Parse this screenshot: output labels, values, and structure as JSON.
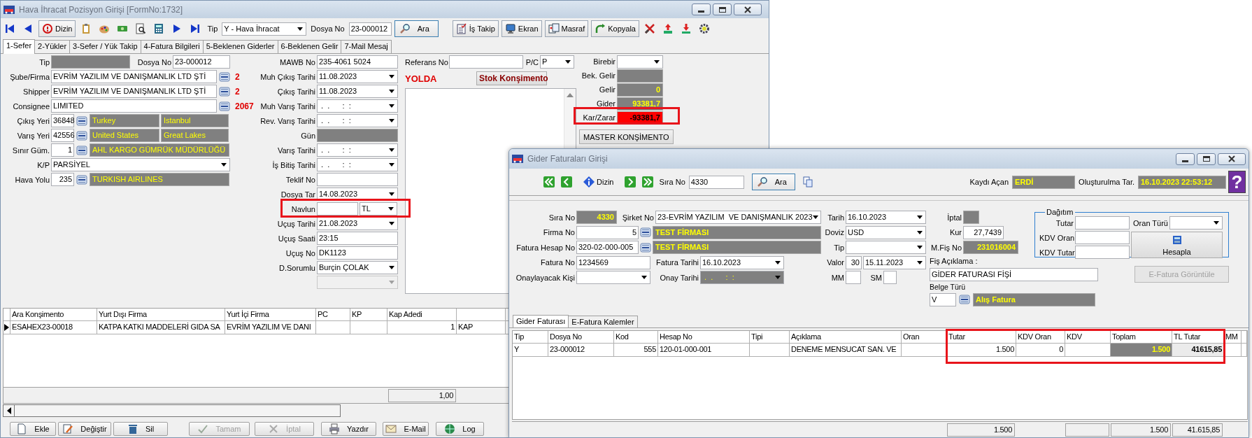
{
  "main_window": {
    "title": "Hava İhracat Pozisyon Girişi [FormNo:1732]",
    "toolbar": [
      {
        "kind": "icon"
      },
      {
        "kind": "icon"
      },
      {
        "kind": "button",
        "label": "Dizin"
      },
      {
        "kind": "icon"
      },
      {
        "kind": "icon"
      },
      {
        "kind": "icon"
      },
      {
        "kind": "icon"
      },
      {
        "kind": "icon"
      },
      {
        "kind": "icon"
      },
      {
        "kind": "icon"
      },
      {
        "kind": "label",
        "text": "Tip"
      },
      {
        "kind": "combo",
        "value": "Y - Hava İhracat"
      },
      {
        "kind": "label",
        "text": "Dosya No"
      },
      {
        "kind": "input",
        "value": "23-000012"
      },
      {
        "kind": "search",
        "label": "Ara"
      },
      {
        "kind": "button",
        "label": "İş Takip"
      },
      {
        "kind": "button",
        "label": "Ekran"
      },
      {
        "kind": "button",
        "label": "Masraf"
      },
      {
        "kind": "button",
        "label": "Kopyala"
      },
      {
        "kind": "icon"
      },
      {
        "kind": "icon"
      },
      {
        "kind": "icon"
      },
      {
        "kind": "icon"
      }
    ],
    "tabs": [
      {
        "label": "1-Sefer",
        "selected": true
      },
      {
        "label": "2-Yükler",
        "selected": false
      },
      {
        "label": "3-Sefer / Yük Takip",
        "selected": false
      },
      {
        "label": "4-Fatura Bilgileri",
        "selected": false
      },
      {
        "label": "5-Beklenen Giderler",
        "selected": false
      },
      {
        "label": "6-Beklenen Gelir",
        "selected": false
      },
      {
        "label": "7-Mail Mesaj",
        "selected": false
      }
    ],
    "form": {
      "columns": [
        {
          "rows": [
            {
              "label": "Tip",
              "fields": [
                {
                  "kind": "gray"
                },
                {
                  "kind": "label",
                  "text": "Dosya No"
                },
                {
                  "kind": "text",
                  "value": "23-000012"
                }
              ]
            },
            {
              "label": "Şube/Firma",
              "fields": [
                {
                  "kind": "text",
                  "value": "EVRİM YAZILIM VE DANIŞMANLIK LTD ŞTİ"
                },
                {
                  "kind": "lookup"
                },
                {
                  "kind": "note",
                  "text": "2"
                }
              ]
            },
            {
              "label": "Shipper",
              "fields": [
                {
                  "kind": "text",
                  "value": "EVRİM YAZILIM VE DANIŞMANLIK LTD ŞTİ"
                },
                {
                  "kind": "lookup"
                },
                {
                  "kind": "note",
                  "text": "2"
                }
              ]
            },
            {
              "label": "Consignee",
              "fields": [
                {
                  "kind": "text",
                  "value": "LIMITED"
                },
                {
                  "kind": "lookup"
                },
                {
                  "kind": "note",
                  "text": "2067"
                }
              ]
            },
            {
              "label": "Çıkış Yeri",
              "fields": [
                {
                  "kind": "text",
                  "value": "36848"
                },
                {
                  "kind": "lookup"
                },
                {
                  "kind": "info",
                  "value": "Turkey"
                },
                {
                  "kind": "info",
                  "value": "Istanbul"
                }
              ]
            },
            {
              "label": "Varış Yeri",
              "fields": [
                {
                  "kind": "text",
                  "value": "42556"
                },
                {
                  "kind": "lookup"
                },
                {
                  "kind": "info",
                  "value": "United States"
                },
                {
                  "kind": "info",
                  "value": "Great Lakes"
                }
              ]
            },
            {
              "label": "Sınır Güm.",
              "fields": [
                {
                  "kind": "number",
                  "value": "1"
                },
                {
                  "kind": "lookup"
                },
                {
                  "kind": "info",
                  "value": "AHL KARGO GÜMRÜK MÜDÜRLÜĞÜ"
                }
              ]
            },
            {
              "label": "K/P",
              "fields": [
                {
                  "kind": "combo",
                  "value": "PARSİYEL"
                }
              ]
            },
            {
              "label": "Hava Yolu",
              "fields": [
                {
                  "kind": "number",
                  "value": "235"
                },
                {
                  "kind": "lookup"
                },
                {
                  "kind": "info",
                  "value": "TURKISH AIRLINES"
                }
              ]
            }
          ]
        },
        {
          "rows": [
            {
              "label": "MAWB No",
              "fields": [
                {
                  "kind": "text",
                  "value": "235-4061 5024"
                }
              ]
            },
            {
              "label": "Muh Çıkış Tarihi",
              "fields": [
                {
                  "kind": "combo",
                  "value": "11.08.2023"
                }
              ]
            },
            {
              "label": "Çıkış Tarihi",
              "fields": [
                {
                  "kind": "combo",
                  "value": "11.08.2023"
                }
              ]
            },
            {
              "label": "Muh Varış Tarihi",
              "fields": [
                {
                  "kind": "combo",
                  "value": " .  .      :  :"
                }
              ]
            },
            {
              "label": "Rev. Varış Tarihi",
              "fields": [
                {
                  "kind": "combo",
                  "value": " .  .      :  :"
                }
              ]
            },
            {
              "label": "Gün",
              "fields": [
                {
                  "kind": "gray"
                }
              ]
            },
            {
              "label": "Varış Tarihi",
              "fields": [
                {
                  "kind": "combo",
                  "value": " .  .      :  :"
                }
              ]
            },
            {
              "label": "İş Bitiş Tarihi",
              "fields": [
                {
                  "kind": "combo",
                  "value": " .  .      :  :"
                }
              ]
            },
            {
              "label": "Teklif No",
              "fields": [
                {
                  "kind": "text"
                }
              ]
            },
            {
              "label": "Dosya Tar",
              "fields": [
                {
                  "kind": "combo",
                  "value": "14.08.2023"
                }
              ]
            },
            {
              "label": "Navlun",
              "highlighted": true,
              "fields": [
                {
                  "kind": "text"
                },
                {
                  "kind": "combo",
                  "value": "TL"
                }
              ]
            },
            {
              "label": "Uçuş Tarihi",
              "fields": [
                {
                  "kind": "combo",
                  "value": "21.08.2023"
                }
              ]
            },
            {
              "label": "Uçuş Saati",
              "fields": [
                {
                  "kind": "text",
                  "value": "23:15"
                }
              ]
            },
            {
              "label": "Uçuş No",
              "fields": [
                {
                  "kind": "text",
                  "value": "DK1123"
                }
              ]
            },
            {
              "label": "D.Sorumlu",
              "fields": [
                {
                  "kind": "combo",
                  "value": "Burçin ÇOLAK"
                }
              ]
            },
            {
              "fields": [
                {
                  "kind": "disabled_combo"
                }
              ]
            }
          ]
        },
        {
          "rows": [
            {
              "label": "Referans No",
              "fields": [
                {
                  "kind": "text"
                },
                {
                  "kind": "label",
                  "text": "P/C"
                },
                {
                  "kind": "combo",
                  "value": "P"
                }
              ]
            },
            {
              "fields": [
                {
                  "kind": "note",
                  "text": "YOLDA"
                },
                {
                  "kind": "accent_button",
                  "label": "Stok Konşimento"
                }
              ]
            },
            {
              "fields": [
                {
                  "kind": "memo"
                }
              ]
            }
          ]
        },
        {
          "rows": [
            {
              "label": "Birebir",
              "fields": [
                {
                  "kind": "combo"
                }
              ]
            },
            {
              "label": "Bek. Gelir",
              "fields": [
                {
                  "kind": "gray"
                }
              ]
            },
            {
              "label": "Gelir",
              "fields": [
                {
                  "kind": "info_num",
                  "value": "0",
                  "bold": true
                }
              ]
            },
            {
              "label": "Gider",
              "fields": [
                {
                  "kind": "info_num",
                  "value": "93381,7",
                  "bold": true
                }
              ]
            },
            {
              "label": "Kar/Zarar",
              "highlighted": true,
              "fields": [
                {
                  "kind": "red_num",
                  "value": "-93381,7",
                  "bold": true
                }
              ]
            },
            {
              "fields": [
                {
                  "kind": "button",
                  "label": "MASTER KONŞİMENTO"
                }
              ]
            }
          ]
        }
      ]
    },
    "grid": {
      "columns": [
        {
          "label": "Ara Konşimento",
          "kind": "text"
        },
        {
          "label": "Yurt Dışı Firma",
          "kind": "text"
        },
        {
          "label": "Yurt İçi Firma",
          "kind": "text"
        },
        {
          "label": "PC",
          "kind": "text"
        },
        {
          "label": "KP",
          "kind": "text"
        },
        {
          "label": "Kap Adedi",
          "kind": "number",
          "has_total": true,
          "total": "1,00"
        },
        {
          "kind": "text"
        }
      ],
      "rows": [
        {
          "selected": true,
          "cells": [
            "ESAHEX23-00018",
            "KATPA KATKI MADDELERİ GIDA SA",
            "EVRİM YAZILIM VE DANI",
            null,
            null,
            "1",
            "KAP"
          ]
        }
      ]
    },
    "buttons": [
      {
        "label": "Ekle",
        "disabled": false
      },
      {
        "label": "Değiştir",
        "disabled": false
      },
      {
        "label": "Sil",
        "disabled": false
      },
      {
        "label": "Tamam",
        "disabled": true
      },
      {
        "label": "İptal",
        "disabled": true
      },
      {
        "label": "Yazdır",
        "disabled": false
      },
      {
        "label": "E-Mail",
        "disabled": false
      },
      {
        "label": "Log",
        "disabled": false
      }
    ]
  },
  "expense_window": {
    "title": "Gider Faturaları Girişi",
    "toolbar": [
      {
        "kind": "icon"
      },
      {
        "kind": "icon"
      },
      {
        "kind": "button",
        "label": "Dizin"
      },
      {
        "kind": "icon"
      },
      {
        "kind": "icon"
      },
      {
        "kind": "label",
        "text": "Sıra No"
      },
      {
        "kind": "input",
        "value": "4330"
      },
      {
        "kind": "search",
        "label": "Ara"
      },
      {
        "kind": "icon"
      }
    ],
    "record": {
      "opened_by_label": "Kaydı Açan",
      "opened_by": "ERDİ",
      "created_label": "Oluşturulma Tar.",
      "created": "16.10.2023 22:53:12",
      "help": "?"
    },
    "form": {
      "columns": [
        {
          "rows": [
            {
              "label": "Sıra No",
              "fields": [
                {
                  "kind": "info_num",
                  "value": "4330",
                  "bold": true
                },
                {
                  "kind": "label",
                  "text": "Şirket No"
                },
                {
                  "kind": "combo",
                  "value": "23-EVRİM YAZILIM  VE DANIŞMANLIK 2023"
                }
              ]
            },
            {
              "label": "Firma No",
              "fields": [
                {
                  "kind": "number",
                  "value": "5"
                },
                {
                  "kind": "lookup"
                },
                {
                  "kind": "info",
                  "value": "TEST FİRMASI",
                  "bold": true
                }
              ]
            },
            {
              "label": "Fatura Hesap No",
              "fields": [
                {
                  "kind": "text",
                  "value": "320-02-000-005"
                },
                {
                  "kind": "lookup"
                },
                {
                  "kind": "info",
                  "value": "TEST FİRMASI",
                  "bold": true
                }
              ]
            },
            {
              "label": "Fatura No",
              "fields": [
                {
                  "kind": "text",
                  "value": "1234569"
                },
                {
                  "kind": "label",
                  "text": "Fatura Tarihi"
                },
                {
                  "kind": "combo",
                  "value": "16.10.2023"
                }
              ]
            },
            {
              "label": "Onaylayacak Kişi",
              "fields": [
                {
                  "kind": "combo"
                },
                {
                  "kind": "label",
                  "text": "Onay Tarihi"
                },
                {
                  "kind": "gray_combo",
                  "value": " .  .      :  :"
                }
              ]
            }
          ]
        },
        {
          "rows": [
            {
              "label": "Tarih",
              "fields": [
                {
                  "kind": "combo",
                  "value": "16.10.2023"
                }
              ]
            },
            {
              "label": "Doviz",
              "fields": [
                {
                  "kind": "combo",
                  "value": "USD"
                }
              ]
            },
            {
              "label": "Tip",
              "fields": [
                {
                  "kind": "combo"
                }
              ]
            },
            {
              "label": "Valor",
              "fields": [
                {
                  "kind": "number",
                  "value": "30"
                },
                {
                  "kind": "combo",
                  "value": "15.11.2023"
                }
              ]
            },
            {
              "label": "MM",
              "fields": [
                {
                  "kind": "text"
                },
                {
                  "kind": "label",
                  "text": "SM"
                },
                {
                  "kind": "text"
                }
              ]
            }
          ]
        },
        {
          "rows": [
            {
              "label": "İptal",
              "fields": [
                {
                  "kind": "gray"
                }
              ]
            },
            {
              "label": "Kur",
              "fields": [
                {
                  "kind": "number",
                  "value": "27,7439"
                }
              ]
            },
            {
              "label": "M.Fiş No",
              "fields": [
                {
                  "kind": "info_num",
                  "value": "231016004",
                  "bold": true
                }
              ]
            },
            {
              "label": "Fiş Açıklama :"
            },
            {
              "fields": [
                {
                  "kind": "text",
                  "value": "GİDER FATURASI FİŞİ"
                }
              ]
            },
            {
              "label": "Belge Türü"
            },
            {
              "fields": [
                {
                  "kind": "text",
                  "value": "V"
                },
                {
                  "kind": "lookup"
                },
                {
                  "kind": "info",
                  "value": "Alış Fatura",
                  "bold": true
                }
              ]
            }
          ]
        }
      ]
    },
    "distribution": {
      "title": "Dağıtım",
      "fields": [
        {
          "label": "Tutar",
          "kind": "text"
        },
        {
          "label": "Oran Türü",
          "kind": "combo"
        },
        {
          "label": "KDV Oran",
          "kind": "text"
        },
        {
          "label": "KDV Tutar",
          "kind": "text"
        }
      ],
      "button": "Hesapla"
    },
    "e_invoice_button": {
      "label": "E-Fatura Görüntüle",
      "disabled": true
    },
    "tabs": [
      {
        "label": "Gider Faturası",
        "selected": true
      },
      {
        "label": "E-Fatura Kalemler",
        "selected": false
      }
    ],
    "grid": {
      "columns": [
        {
          "label": "Tip",
          "kind": "text"
        },
        {
          "label": "Dosya No",
          "kind": "text"
        },
        {
          "label": "Kod",
          "kind": "number"
        },
        {
          "label": "Hesap No",
          "kind": "text"
        },
        {
          "label": "Tipi",
          "kind": "text"
        },
        {
          "label": "Açıklama",
          "kind": "text"
        },
        {
          "label": "Oran",
          "kind": "text"
        },
        {
          "label": "Tutar",
          "kind": "number",
          "highlighted": true,
          "has_total": true,
          "total": "1.500"
        },
        {
          "label": "KDV Oran",
          "kind": "number",
          "highlighted": true
        },
        {
          "label": "KDV",
          "kind": "number",
          "highlighted": true,
          "has_total": true
        },
        {
          "label": "Toplam",
          "kind": "sum",
          "highlighted": true,
          "has_total": true,
          "total": "1.500"
        },
        {
          "label": "TL Tutar",
          "kind": "tl",
          "highlighted": true,
          "has_total": true,
          "total": "41.615,85"
        },
        {
          "label": "MM",
          "kind": "text"
        }
      ],
      "rows": [
        {
          "cells": [
            "Y",
            "23-000012",
            "555",
            "120-01-000-001",
            null,
            "DENEME MENSUCAT SAN. VE",
            null,
            "1.500",
            "0",
            null,
            "1.500",
            "41615,85",
            null
          ]
        }
      ]
    }
  }
}
